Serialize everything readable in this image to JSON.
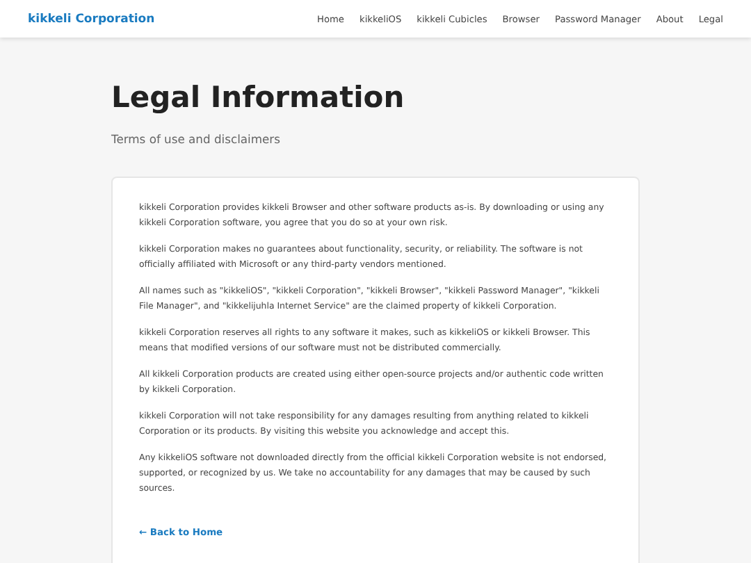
{
  "header": {
    "brand": "kikkeli Corporation",
    "nav": [
      "Home",
      "kikkeliOS",
      "kikkeli Cubicles",
      "Browser",
      "Password Manager",
      "About",
      "Legal"
    ]
  },
  "page": {
    "title": "Legal Information",
    "subtitle": "Terms of use and disclaimers"
  },
  "paragraphs": [
    "kikkeli Corporation provides kikkeli Browser and other software products as-is. By downloading or using any kikkeli Corporation software, you agree that you do so at your own risk.",
    "kikkeli Corporation makes no guarantees about functionality, security, or reliability. The software is not officially affiliated with Microsoft or any third-party vendors mentioned.",
    "All names such as \"kikkeliOS\", \"kikkeli Corporation\", \"kikkeli Browser\", \"kikkeli Password Manager\", \"kikkeli File Manager\", and \"kikkelijuhla Internet Service\" are the claimed property of kikkeli Corporation.",
    "kikkeli Corporation reserves all rights to any software it makes, such as kikkeliOS or kikkeli Browser. This means that modified versions of our software must not be distributed commercially.",
    "All kikkeli Corporation products are created using either open-source projects and/or authentic code written by kikkeli Corporation.",
    "kikkeli Corporation will not take responsibility for any damages resulting from anything related to kikkeli Corporation or its products. By visiting this website you acknowledge and accept this.",
    "Any kikkeliOS software not downloaded directly from the official kikkeli Corporation website is not endorsed, supported, or recognized by us. We take no accountability for any damages that may be caused by such sources."
  ],
  "back_link": "← Back to Home"
}
